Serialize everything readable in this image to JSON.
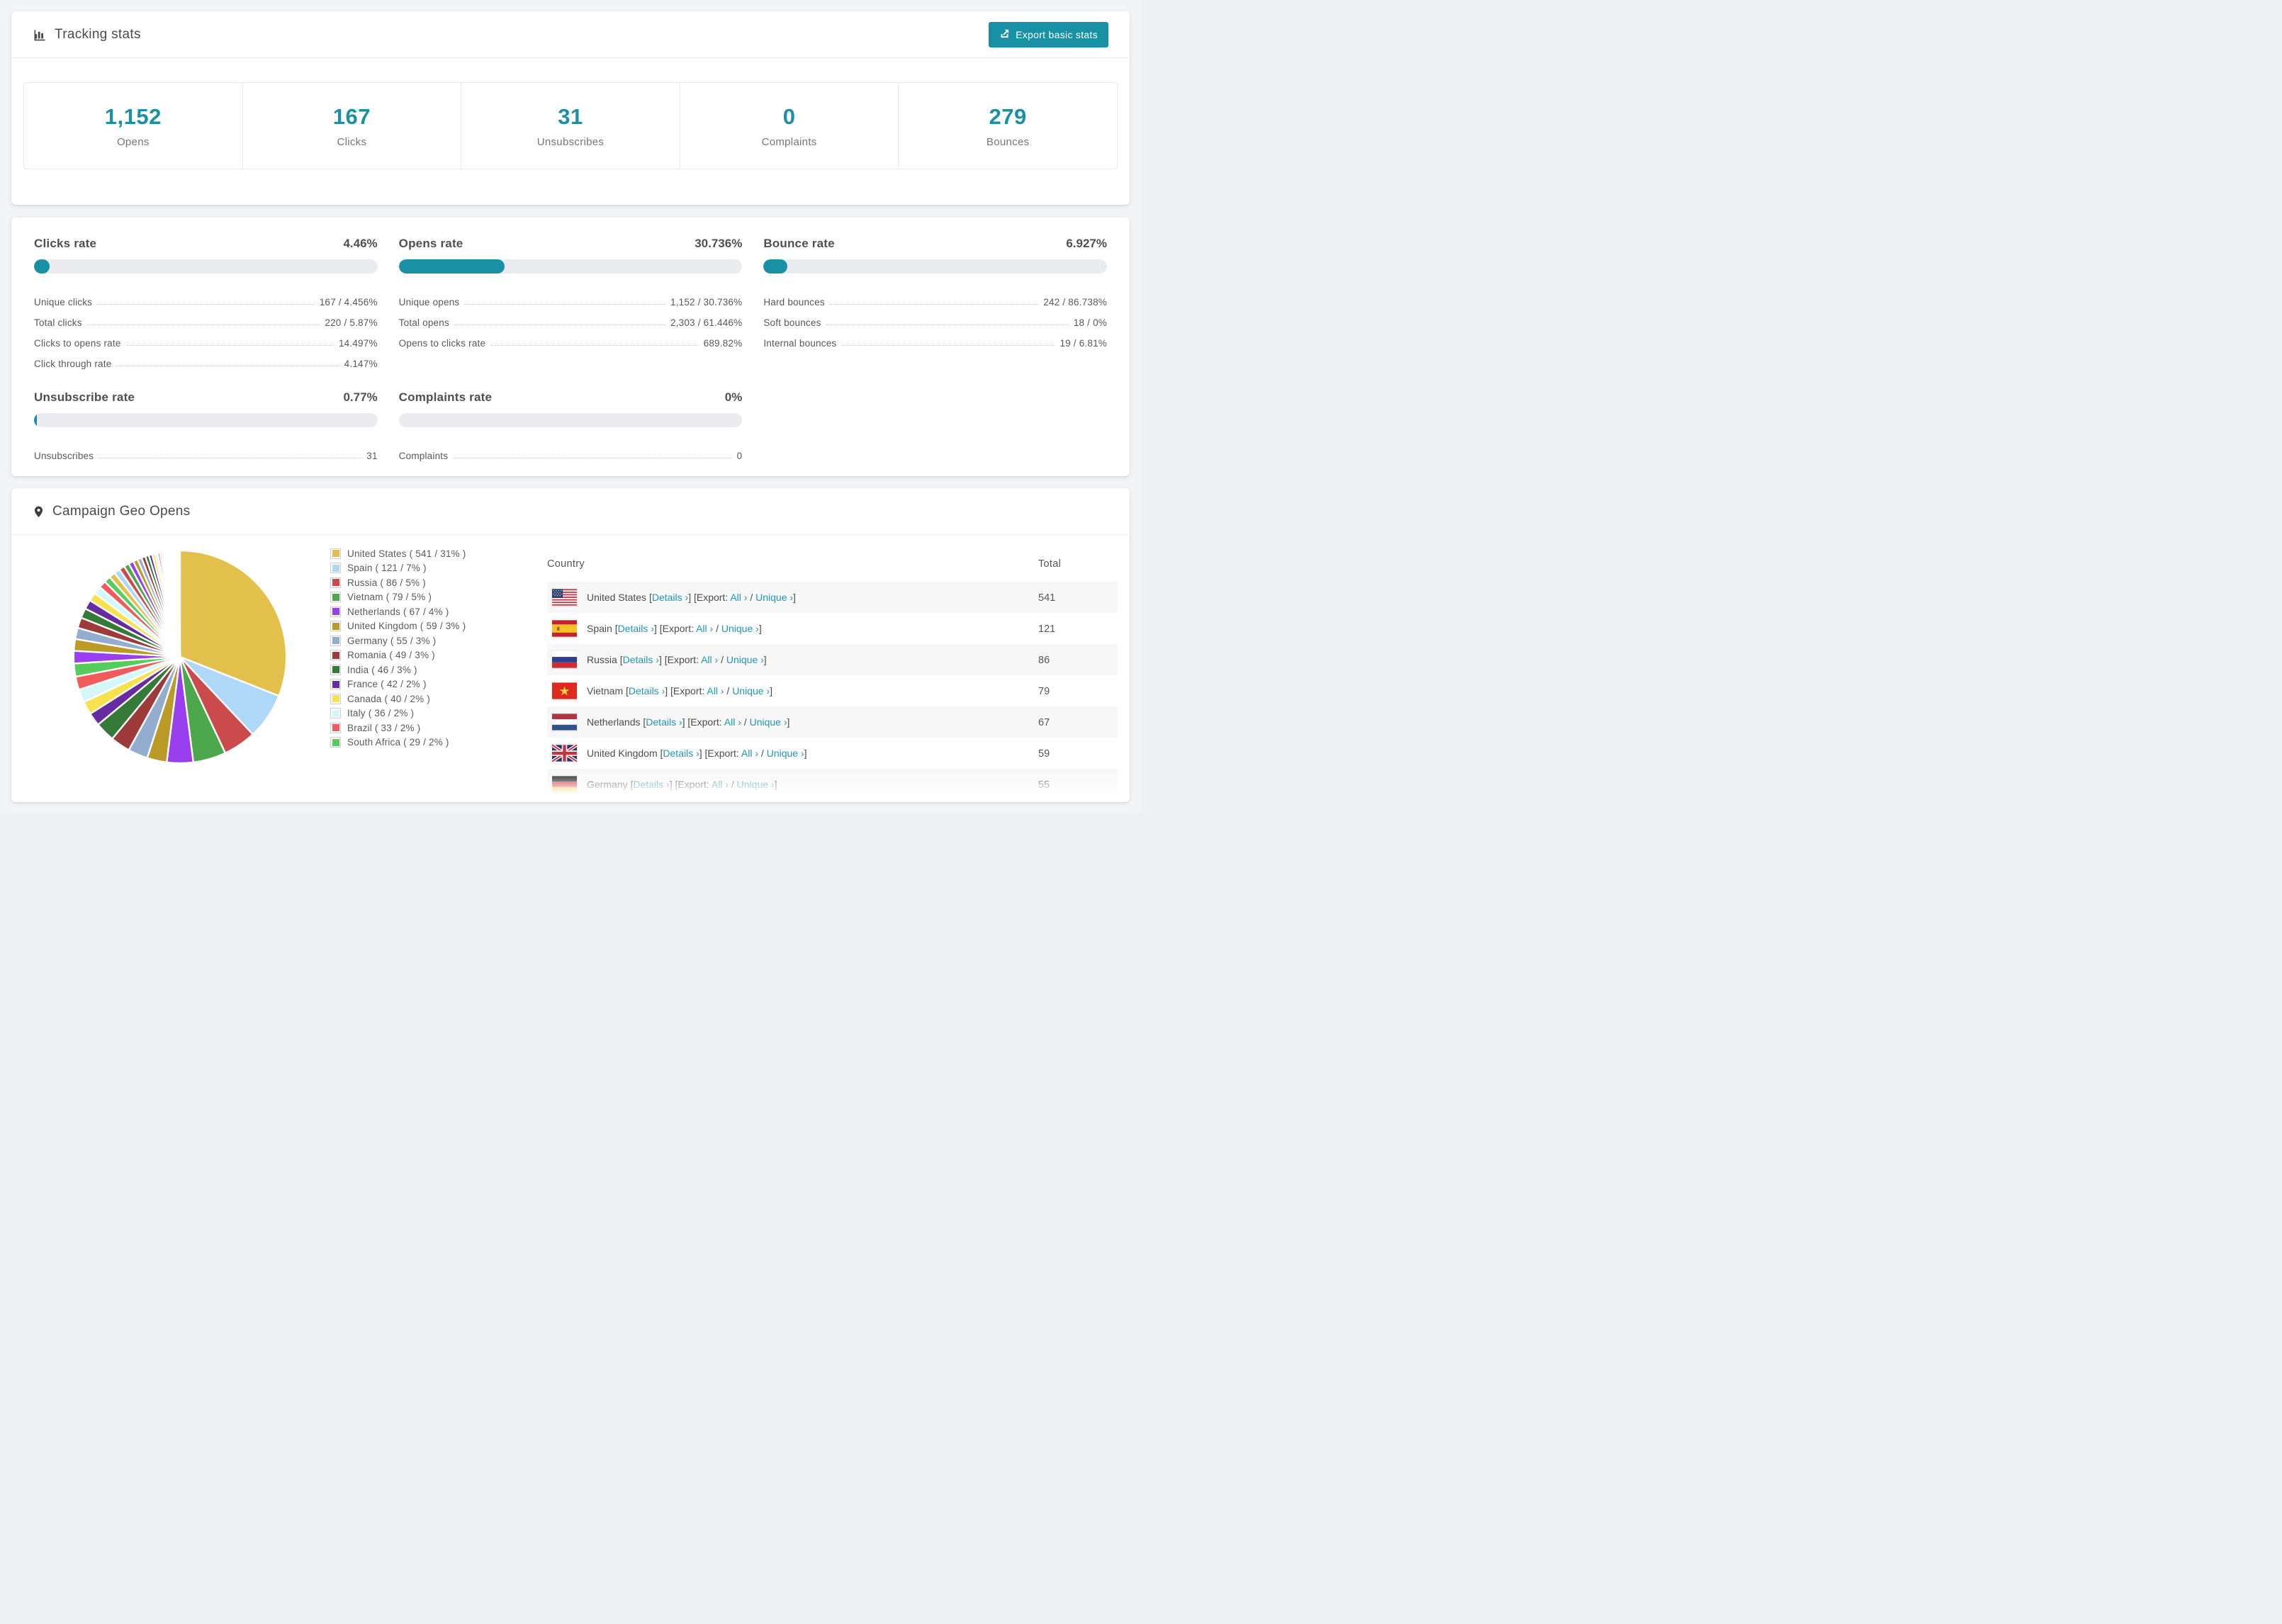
{
  "tracking": {
    "title": "Tracking stats",
    "export_button": "Export basic stats",
    "summary": [
      {
        "value": "1,152",
        "label": "Opens"
      },
      {
        "value": "167",
        "label": "Clicks"
      },
      {
        "value": "31",
        "label": "Unsubscribes"
      },
      {
        "value": "0",
        "label": "Complaints"
      },
      {
        "value": "279",
        "label": "Bounces"
      }
    ]
  },
  "rates": [
    {
      "title": "Clicks rate",
      "value": "4.46%",
      "pct": 4.46,
      "rows": [
        {
          "label": "Unique clicks",
          "value": "167 / 4.456%"
        },
        {
          "label": "Total clicks",
          "value": "220 / 5.87%"
        },
        {
          "label": "Clicks to opens rate",
          "value": "14.497%"
        },
        {
          "label": "Click through rate",
          "value": "4.147%"
        }
      ]
    },
    {
      "title": "Opens rate",
      "value": "30.736%",
      "pct": 30.736,
      "rows": [
        {
          "label": "Unique opens",
          "value": "1,152 / 30.736%"
        },
        {
          "label": "Total opens",
          "value": "2,303 / 61.446%"
        },
        {
          "label": "Opens to clicks rate",
          "value": "689.82%"
        }
      ]
    },
    {
      "title": "Bounce rate",
      "value": "6.927%",
      "pct": 6.927,
      "rows": [
        {
          "label": "Hard bounces",
          "value": "242 / 86.738%"
        },
        {
          "label": "Soft bounces",
          "value": "18 / 0%"
        },
        {
          "label": "Internal bounces",
          "value": "19 / 6.81%"
        }
      ]
    },
    {
      "title": "Unsubscribe rate",
      "value": "0.77%",
      "pct": 0.77,
      "rows": [
        {
          "label": "Unsubscribes",
          "value": "31"
        }
      ]
    },
    {
      "title": "Complaints rate",
      "value": "0%",
      "pct": 0,
      "rows": [
        {
          "label": "Complaints",
          "value": "0"
        }
      ]
    }
  ],
  "geo": {
    "title": "Campaign Geo Opens",
    "columns": {
      "country": "Country",
      "total": "Total"
    },
    "links": {
      "bracket_open": "[",
      "bracket_close": "]",
      "details": "Details ›",
      "export_prefix": "[Export:",
      "all": "All ›",
      "slash": "/",
      "unique": "Unique ›"
    },
    "rows": [
      {
        "country": "United States",
        "flag": "us",
        "total": "541"
      },
      {
        "country": "Spain",
        "flag": "es",
        "total": "121"
      },
      {
        "country": "Russia",
        "flag": "ru",
        "total": "86"
      },
      {
        "country": "Vietnam",
        "flag": "vn",
        "total": "79"
      },
      {
        "country": "Netherlands",
        "flag": "nl",
        "total": "67"
      },
      {
        "country": "United Kingdom",
        "flag": "gb",
        "total": "59"
      },
      {
        "country": "Germany",
        "flag": "de",
        "total": "55"
      }
    ]
  },
  "chart_data": {
    "type": "pie",
    "title": "Campaign Geo Opens",
    "legend_position": "right",
    "start_angle": "top",
    "direction": "clockwise",
    "series": [
      {
        "name": "United States",
        "value": 541,
        "pct": 31,
        "color": "#e3c04c",
        "legend": "United States ( 541 / 31% )"
      },
      {
        "name": "Spain",
        "value": 121,
        "pct": 7,
        "color": "#afd8f8",
        "legend": "Spain ( 121 / 7% )"
      },
      {
        "name": "Russia",
        "value": 86,
        "pct": 5,
        "color": "#cb4b4c",
        "legend": "Russia ( 86 / 5% )"
      },
      {
        "name": "Vietnam",
        "value": 79,
        "pct": 5,
        "color": "#4da74d",
        "legend": "Vietnam ( 79 / 5% )"
      },
      {
        "name": "Netherlands",
        "value": 67,
        "pct": 4,
        "color": "#9a3fee",
        "legend": "Netherlands ( 67 / 4% )"
      },
      {
        "name": "United Kingdom",
        "value": 59,
        "pct": 3,
        "color": "#bb9a27",
        "legend": "United Kingdom ( 59 / 3% )"
      },
      {
        "name": "Germany",
        "value": 55,
        "pct": 3,
        "color": "#92adce",
        "legend": "Germany ( 55 / 3% )"
      },
      {
        "name": "Romania",
        "value": 49,
        "pct": 3,
        "color": "#9d3b3b",
        "legend": "Romania ( 49 / 3% )"
      },
      {
        "name": "India",
        "value": 46,
        "pct": 3,
        "color": "#357a38",
        "legend": "India ( 46 / 3% )"
      },
      {
        "name": "France",
        "value": 42,
        "pct": 2,
        "color": "#672da0",
        "legend": "France ( 42 / 2% )"
      },
      {
        "name": "Canada",
        "value": 40,
        "pct": 2,
        "color": "#f7e14d",
        "legend": "Canada ( 40 / 2% )"
      },
      {
        "name": "Italy",
        "value": 36,
        "pct": 2,
        "color": "#d5f6fa",
        "legend": "Italy ( 36 / 2% )"
      },
      {
        "name": "Brazil",
        "value": 33,
        "pct": 2,
        "color": "#f15b5c",
        "legend": "Brazil ( 33 / 2% )"
      },
      {
        "name": "South Africa",
        "value": 29,
        "pct": 2,
        "color": "#57cc5e",
        "legend": "South Africa ( 29 / 2% )"
      }
    ],
    "others_pct": [
      1.9,
      1.8,
      1.7,
      1.6,
      1.5,
      1.4,
      1.3,
      1.2,
      1.1,
      1.0,
      0.95,
      0.9,
      0.85,
      0.8,
      0.75,
      0.7,
      0.65,
      0.6,
      0.55,
      0.5,
      0.45,
      0.4,
      0.35,
      0.3,
      0.28,
      0.26,
      0.24,
      0.22,
      0.2,
      0.18,
      0.16,
      0.14,
      0.12,
      0.1,
      0.09,
      0.08,
      0.07,
      0.06,
      0.05,
      0.05,
      0.04,
      0.04,
      0.04,
      0.04,
      0.04,
      0.04,
      0.04,
      0.04,
      0.04,
      0.04
    ]
  },
  "colors": {
    "accent": "#1a90a4",
    "link": "#2097b7",
    "stripe": "#f7f7f8",
    "track": "#eaecef"
  }
}
